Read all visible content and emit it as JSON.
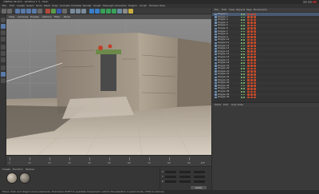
{
  "window": {
    "title": "CINEMA 4D R13 - [Untitled 1 *] - Main",
    "minimize_icon": "minimize-icon",
    "maximize_icon": "maximize-icon",
    "close_icon": "close-icon"
  },
  "menubar": {
    "items": [
      "File",
      "Edit",
      "Create",
      "Select",
      "Tools",
      "Mesh",
      "Snap",
      "Animate",
      "Simulate",
      "Render",
      "Sculpt",
      "MoGraph",
      "Character",
      "Plugins",
      "Script",
      "Window",
      "Help"
    ]
  },
  "toolbar": {
    "icons": [
      "undo-icon",
      "redo-icon",
      "live-select-icon",
      "move-icon",
      "scale-icon",
      "rotate-icon",
      "recent-tools-icon",
      "x-axis-icon",
      "y-axis-icon",
      "z-axis-icon",
      "coordinate-system-icon",
      "render-view-icon",
      "render-picture-viewer-icon",
      "render-settings-icon",
      "cube-icon",
      "pen-icon",
      "subdivision-icon",
      "array-icon",
      "boole-icon",
      "floor-icon",
      "camera-icon",
      "light-icon"
    ],
    "colors": [
      "#6a6a6a",
      "#6a6a6a",
      "#5a7aa8",
      "#5a7aa8",
      "#5a7aa8",
      "#5a7aa8",
      "#6a6a6a",
      "#b24a3a",
      "#5a9a4a",
      "#3a5ab2",
      "#6a6a6a",
      "#7a8a9a",
      "#7a8a9a",
      "#7a8a9a",
      "#3a7fc8",
      "#3a7fc8",
      "#3aa05a",
      "#3aa05a",
      "#3aa05a",
      "#6a8aa0",
      "#8a8a8a",
      "#c8b040"
    ]
  },
  "left_tools": {
    "icons": [
      "make-editable-icon",
      "model-mode-icon",
      "texture-mode-icon",
      "axis-mode-icon",
      "points-mode-icon",
      "edges-mode-icon",
      "polygons-mode-icon",
      "snapping-icon",
      "workplane-icon",
      "solo-icon"
    ]
  },
  "viewport": {
    "menu": [
      "View",
      "Cameras",
      "Display",
      "Options",
      "Filter",
      "Panel"
    ],
    "label": "Perspective"
  },
  "timeline": {
    "frames": [
      "0",
      "10",
      "20",
      "30",
      "40",
      "50",
      "60",
      "70",
      "80",
      "90"
    ],
    "current_frame": "0 F"
  },
  "materials": {
    "menu": [
      "Create",
      "Function",
      "Texture"
    ],
    "swatches": [
      "stone-material",
      "ground-material"
    ]
  },
  "coords": {
    "rows": [
      {
        "label": "X"
      },
      {
        "label": "Y"
      },
      {
        "label": "Z"
      }
    ],
    "apply_label": "Apply"
  },
  "objects": {
    "menu": [
      "File",
      "Edit",
      "View",
      "Objects",
      "Tags",
      "Bookmarks"
    ],
    "rows": [
      "Polygon.1",
      "Polygon.2",
      "Polygon.3",
      "Polygon.4",
      "Polygon.5",
      "Polygon.6",
      "Polygon.7",
      "Polygon.8",
      "Polygon.9",
      "Polygon.10",
      "Polygon.11",
      "Polygon.12",
      "Polygon.13",
      "Polygon.14",
      "Polygon.15",
      "Polygon.16",
      "Polygon.17",
      "Polygon.18",
      "Polygon.19",
      "Polygon.20",
      "Polygon.21",
      "Polygon.22",
      "Polygon.23",
      "Polygon.24",
      "Polygon.25",
      "Polygon.26",
      "Polygon.27",
      "Polygon.28",
      "Polygon.29",
      "Polygon.30"
    ]
  },
  "attributes": {
    "menu": [
      "Mode",
      "Edit",
      "User Data"
    ]
  },
  "status": {
    "text": "Move: Click and drag to move elements. Hold down SHIFT to quantize movement / add to the selection in point mode, CTRL to remove."
  }
}
